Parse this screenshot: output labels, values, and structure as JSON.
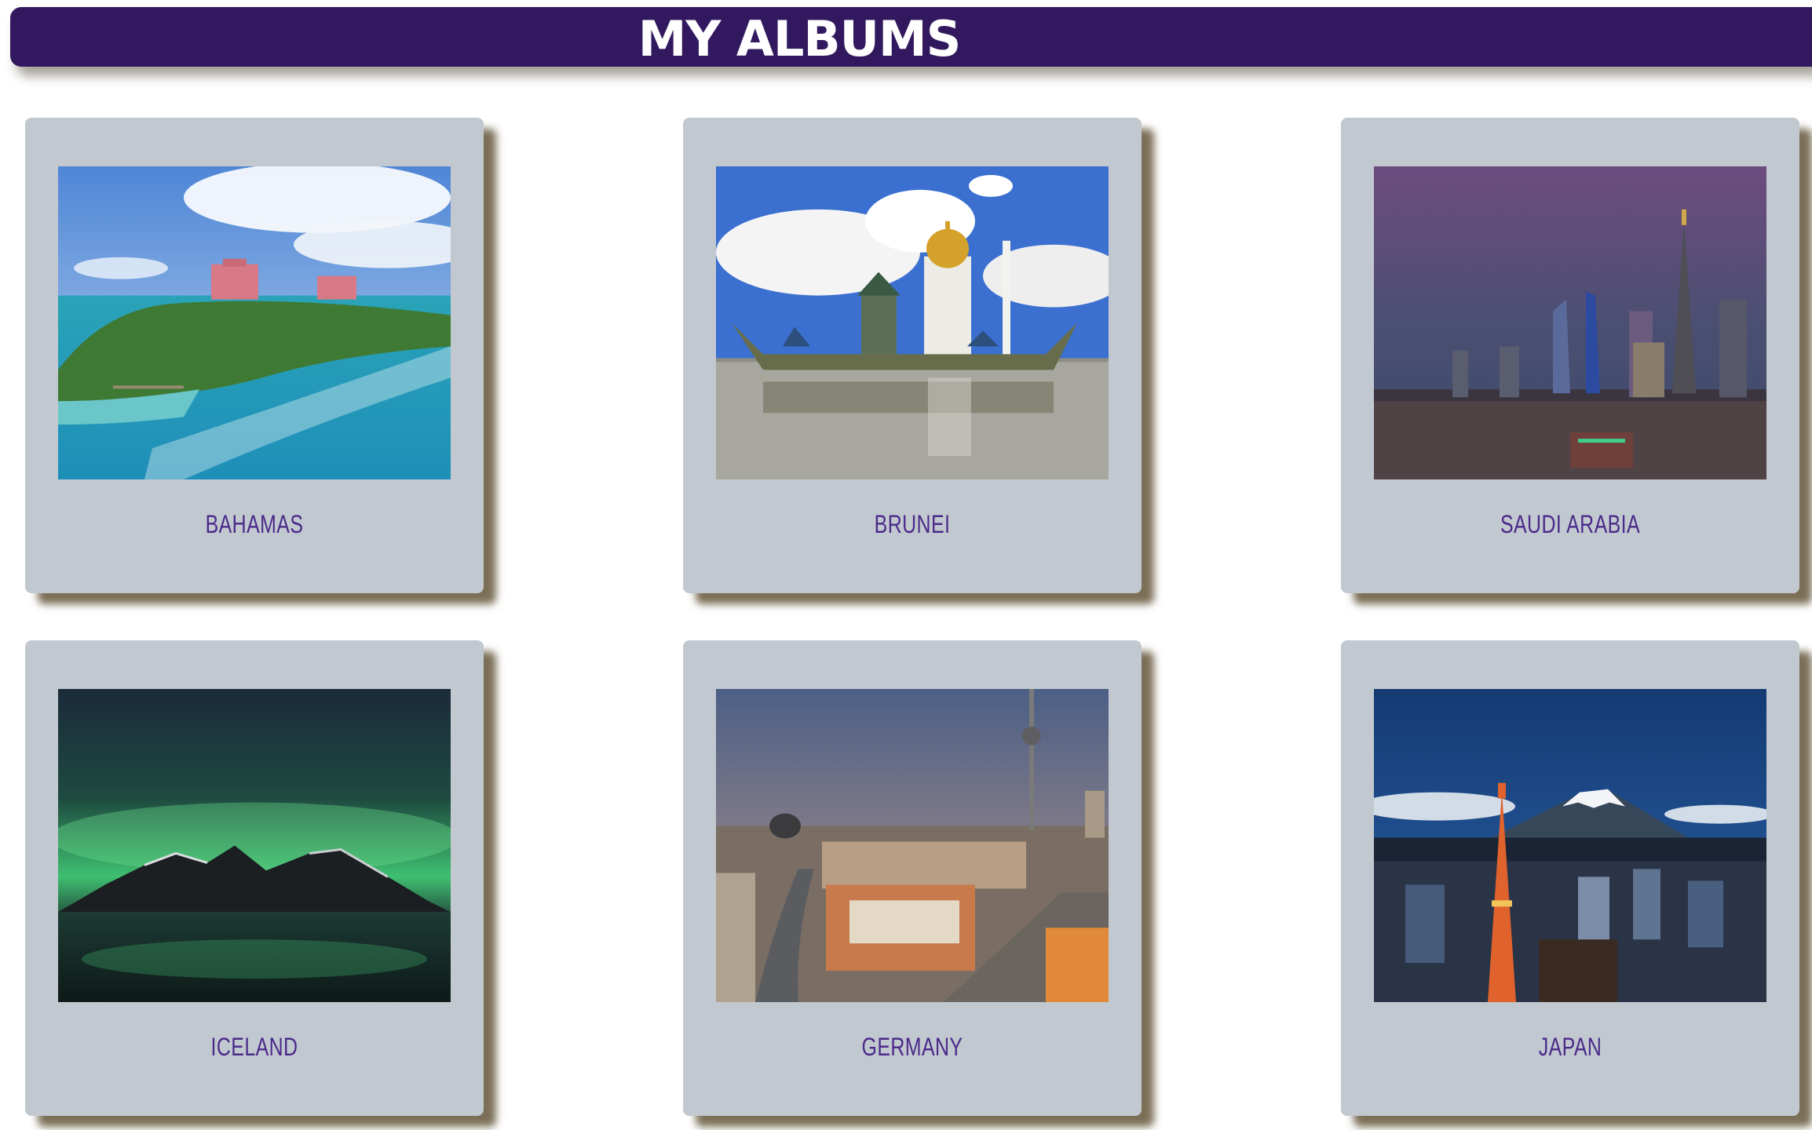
{
  "header": {
    "title": "MY ALBUMS"
  },
  "albums": [
    {
      "label": "BAHAMAS"
    },
    {
      "label": "BRUNEI"
    },
    {
      "label": "SAUDI ARABIA"
    },
    {
      "label": "ICELAND"
    },
    {
      "label": "GERMANY"
    },
    {
      "label": "JAPAN"
    }
  ],
  "colors": {
    "header_bg": "#32195f",
    "card_bg": "#c2c8d0",
    "caption": "#4a2a8a"
  }
}
